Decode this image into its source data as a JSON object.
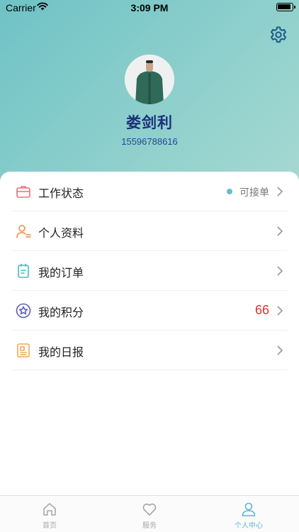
{
  "status_bar": {
    "carrier": "Carrier",
    "time": "3:09 PM"
  },
  "profile": {
    "name": "娄剑利",
    "phone": "15596788616"
  },
  "menu": {
    "items": [
      {
        "label": "工作状态",
        "icon": "briefcase-icon",
        "status": "可接单",
        "status_color": "#6cb9cf"
      },
      {
        "label": "个人资料",
        "icon": "user-profile-icon"
      },
      {
        "label": "我的订单",
        "icon": "order-clipboard-icon"
      },
      {
        "label": "我的积分",
        "icon": "star-circle-icon",
        "value": "66",
        "value_color": "#d9322a"
      },
      {
        "label": "我的日报",
        "icon": "daily-report-icon"
      }
    ]
  },
  "tabs": [
    {
      "label": "首页",
      "icon": "home-icon",
      "active": false
    },
    {
      "label": "服务",
      "icon": "heart-icon",
      "active": false
    },
    {
      "label": "个人中心",
      "icon": "person-icon",
      "active": true
    }
  ],
  "colors": {
    "accent": "#5cb6d1",
    "header_gradient_start": "#6fc2c6",
    "header_gradient_end": "#aad9d3",
    "name_color": "#1d2f7a"
  }
}
